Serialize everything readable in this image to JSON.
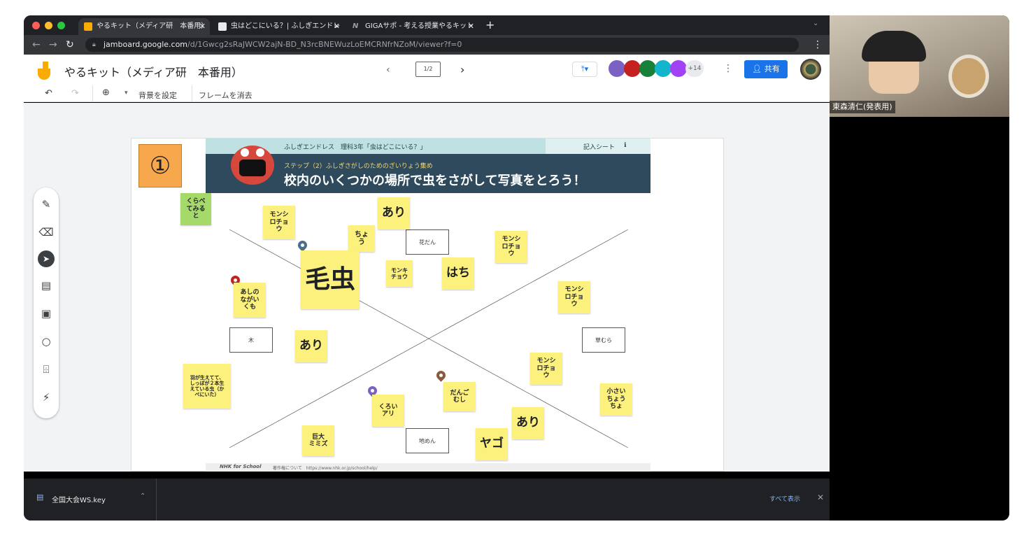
{
  "browser": {
    "tabs": [
      {
        "title": "やるキット（メディア研　本番用）",
        "fav_color": "#f9ab00",
        "active": true
      },
      {
        "title": "虫はどこにいる？| ふしぎエンドレ",
        "fav_color": "#e8eaed",
        "active": false
      },
      {
        "title": "GIGAサポ - 考える授業やるキット",
        "fav_color": "#9aa0a6",
        "active": false
      }
    ],
    "new_tab": "+",
    "url_host": "jamboard.google.com",
    "url_path": "/d/1Gwcg2sRaJWCW2ajN-BD_N3rcBNEWuzLoEMCRNfrNZoM/viewer?f=0"
  },
  "jamboard": {
    "title": "やるキット（メディア研　本番用）",
    "page_indicator": "1/2",
    "extra_collaborators": "+14",
    "share_label": "共有",
    "toolbar": {
      "set_background": "背景を設定",
      "clear_frame": "フレームを消去"
    }
  },
  "frame": {
    "number_badge": "①",
    "banner_top": "ふしぎエンドレス　理科3年「虫はどこにいる？」",
    "banner_sheet": "記入シート",
    "banner_step": "ステップ（2）ふしぎさがしのためのざいりょう集め",
    "banner_main": "校内のいくつかの場所で虫をさがして写真をとろう！",
    "footer_brand": "NHK for School",
    "footer_text": "著作権について　https://www.nhk.or.jp/school/help/",
    "stickies": [
      {
        "id": "kurabete",
        "text": "くらべ\nてみる\nと",
        "color": "#a5d96a"
      },
      {
        "id": "monshi1",
        "text": "モンシ\nロチョ\nウ"
      },
      {
        "id": "ari1",
        "text": "あり"
      },
      {
        "id": "chou",
        "text": "ちょ\nう"
      },
      {
        "id": "monshi2",
        "text": "モンシ\nロチョ\nウ"
      },
      {
        "id": "kemushi",
        "text": "毛虫"
      },
      {
        "id": "monki",
        "text": "モンキ\nチョウ"
      },
      {
        "id": "hachi",
        "text": "はち"
      },
      {
        "id": "monshi3",
        "text": "モンシ\nロチョ\nウ"
      },
      {
        "id": "ashinagagumo",
        "text": "あしの\nながい\nくも"
      },
      {
        "id": "ari2",
        "text": "あり"
      },
      {
        "id": "monshi4",
        "text": "モンシ\nロチョ\nウ"
      },
      {
        "id": "hane",
        "text": "羽が生えてて、\nしっぽが２本生\nえている虫（か\nべにいた）"
      },
      {
        "id": "dangomushi",
        "text": "だんご\nむし"
      },
      {
        "id": "chiisai",
        "text": "小さい\nちょう\nちょ"
      },
      {
        "id": "kuroiari",
        "text": "くろい\nアリ"
      },
      {
        "id": "ari3",
        "text": "あり"
      },
      {
        "id": "kyodai",
        "text": "巨大\nミミズ"
      },
      {
        "id": "yago",
        "text": "ヤゴ"
      }
    ],
    "location_boxes": {
      "kadan": "花だん",
      "ki": "木",
      "kusamura": "草むら",
      "jimen": "地めん"
    }
  },
  "download_bar": {
    "file": "全国大会WS.key",
    "show_all": "すべて表示",
    "close": "✕"
  },
  "video": {
    "name": "東森清仁(発表用)"
  }
}
